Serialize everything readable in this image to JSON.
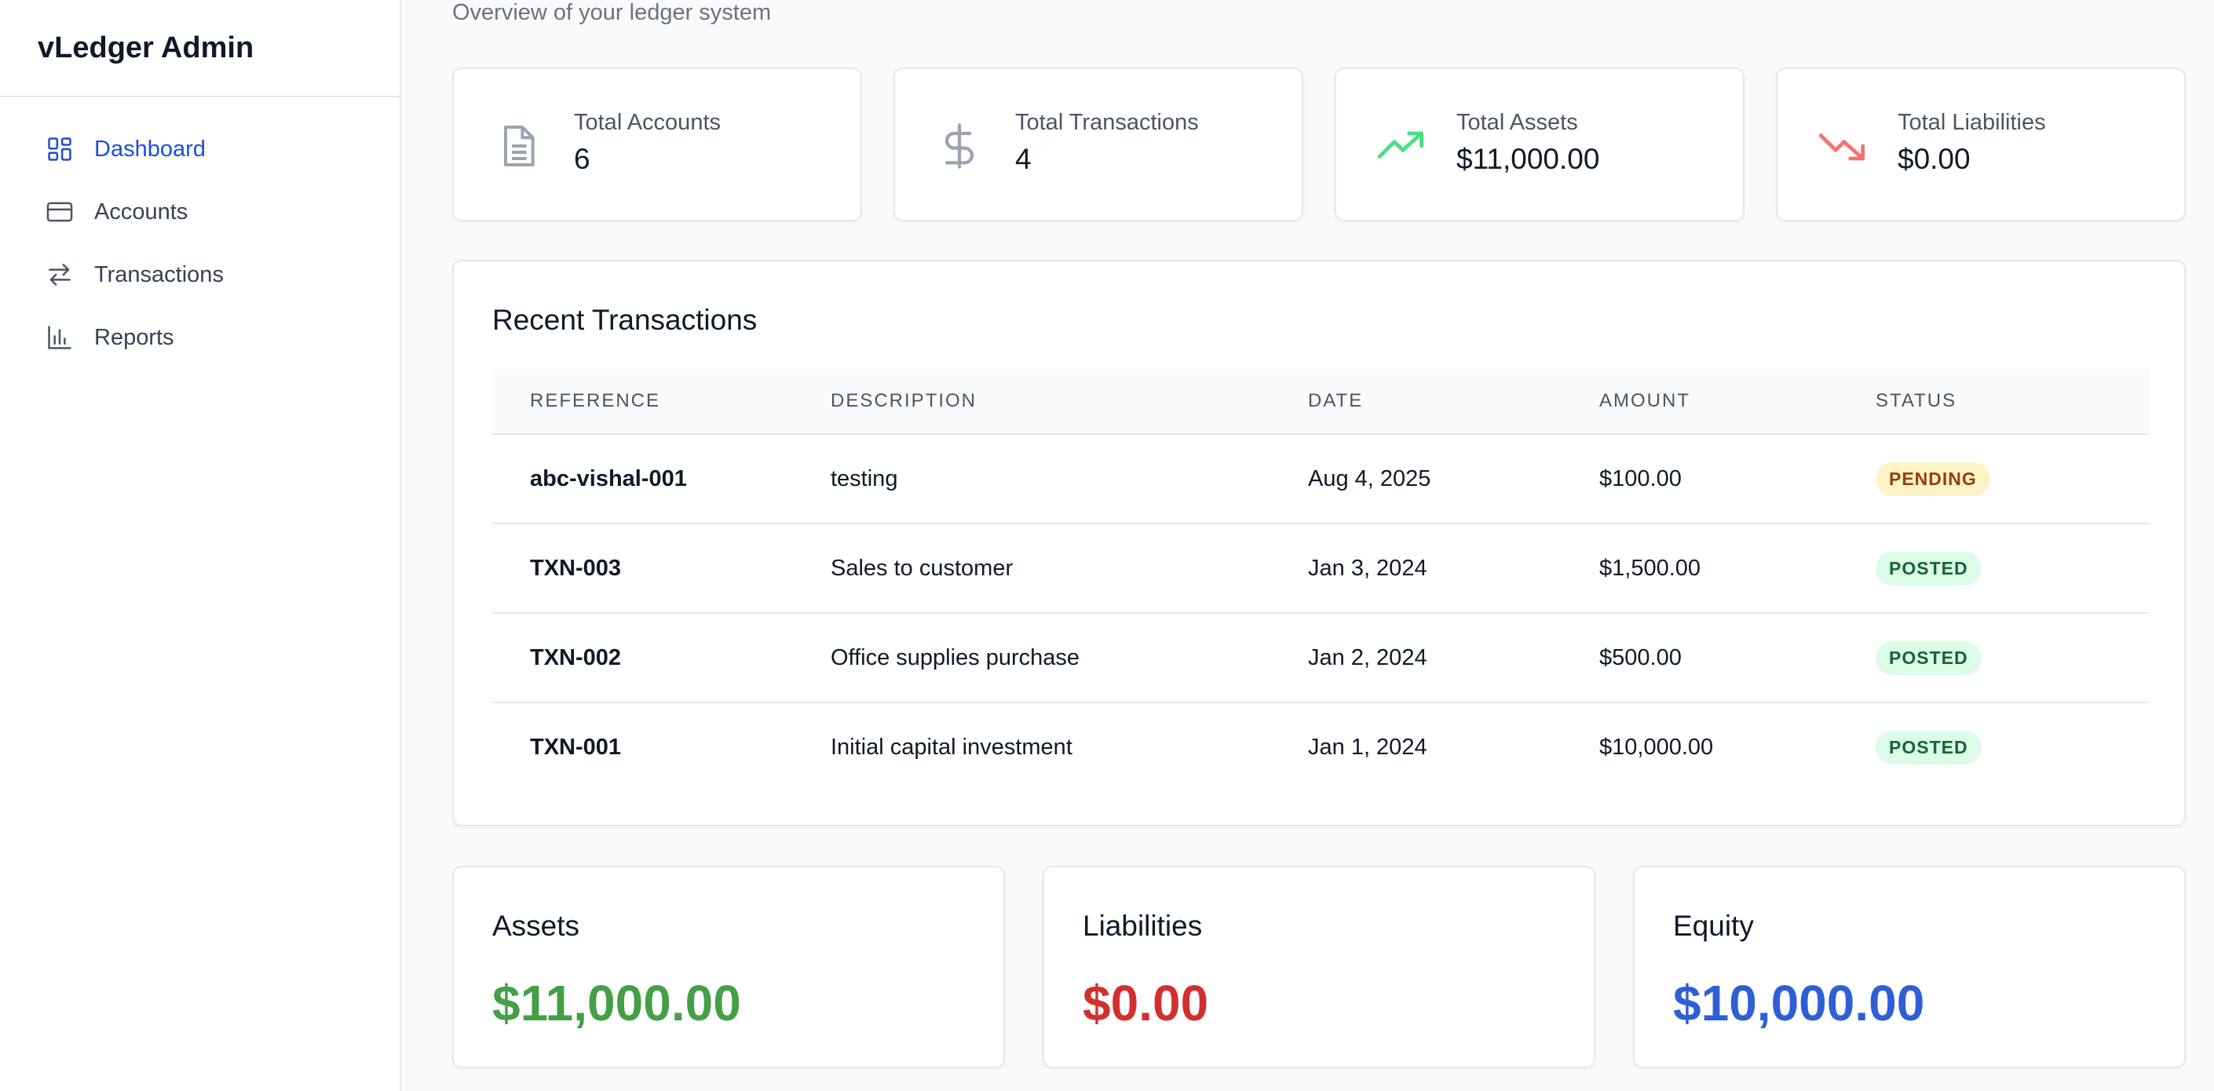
{
  "app": {
    "title": "vLedger Admin"
  },
  "sidebar": {
    "items": [
      {
        "label": "Dashboard",
        "icon": "dashboard-grid-icon",
        "active": true
      },
      {
        "label": "Accounts",
        "icon": "credit-card-icon",
        "active": false
      },
      {
        "label": "Transactions",
        "icon": "arrows-swap-icon",
        "active": false
      },
      {
        "label": "Reports",
        "icon": "bar-chart-icon",
        "active": false
      }
    ]
  },
  "page": {
    "subtitle": "Overview of your ledger system"
  },
  "stats": [
    {
      "label": "Total Accounts",
      "value": "6",
      "icon": "document-icon",
      "color": "#9ca3af"
    },
    {
      "label": "Total Transactions",
      "value": "4",
      "icon": "dollar-icon",
      "color": "#9ca3af"
    },
    {
      "label": "Total Assets",
      "value": "$11,000.00",
      "icon": "trending-up-icon",
      "color": "#4ade80"
    },
    {
      "label": "Total Liabilities",
      "value": "$0.00",
      "icon": "trending-down-icon",
      "color": "#f87171"
    }
  ],
  "transactions": {
    "title": "Recent Transactions",
    "columns": [
      "REFERENCE",
      "DESCRIPTION",
      "DATE",
      "AMOUNT",
      "STATUS"
    ],
    "rows": [
      {
        "reference": "abc-vishal-001",
        "description": "testing",
        "date": "Aug 4, 2025",
        "amount": "$100.00",
        "status": "PENDING"
      },
      {
        "reference": "TXN-003",
        "description": "Sales to customer",
        "date": "Jan 3, 2024",
        "amount": "$1,500.00",
        "status": "POSTED"
      },
      {
        "reference": "TXN-002",
        "description": "Office supplies purchase",
        "date": "Jan 2, 2024",
        "amount": "$500.00",
        "status": "POSTED"
      },
      {
        "reference": "TXN-001",
        "description": "Initial capital investment",
        "date": "Jan 1, 2024",
        "amount": "$10,000.00",
        "status": "POSTED"
      }
    ]
  },
  "summary": [
    {
      "label": "Assets",
      "value": "$11,000.00",
      "color": "#43a047"
    },
    {
      "label": "Liabilities",
      "value": "$0.00",
      "color": "#d32f2f"
    },
    {
      "label": "Equity",
      "value": "$10,000.00",
      "color": "#2f5fd6"
    }
  ]
}
